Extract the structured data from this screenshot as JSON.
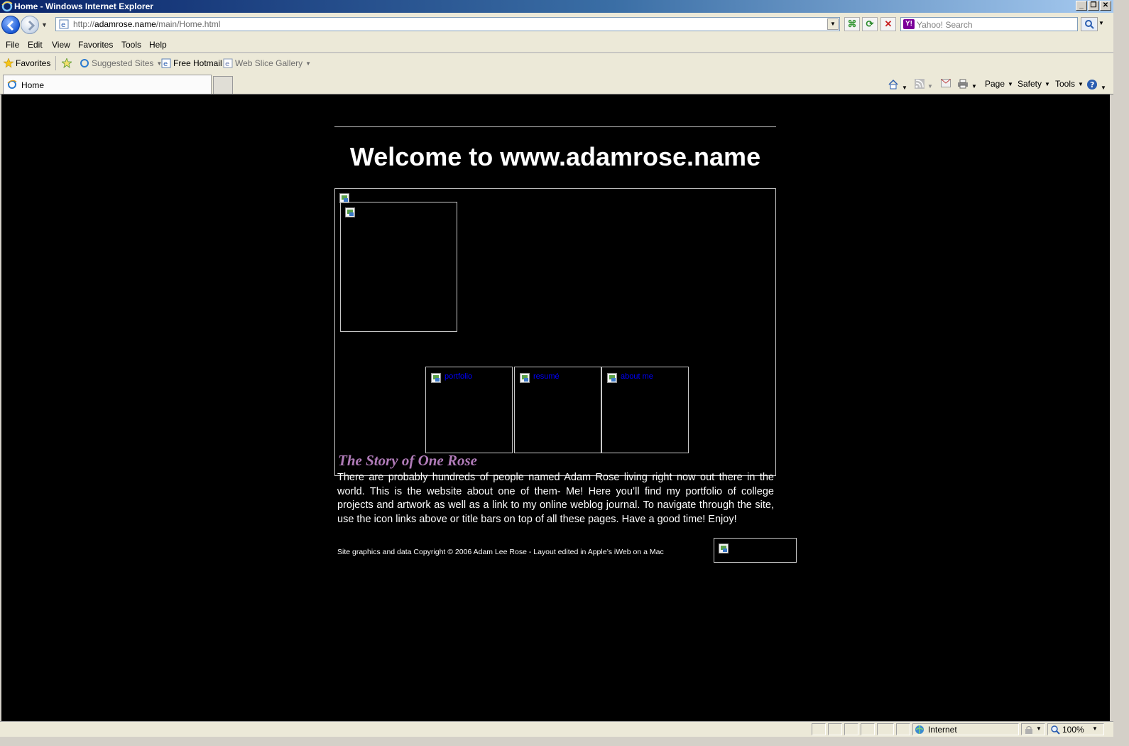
{
  "window": {
    "title": "Home - Windows Internet Explorer"
  },
  "address": {
    "url_prefix": "http://",
    "url_domain": "adamrose.name",
    "url_path": "/main/Home.html"
  },
  "search": {
    "placeholder": "Yahoo! Search",
    "provider_icon": "Y!"
  },
  "menu": [
    "File",
    "Edit",
    "View",
    "Favorites",
    "Tools",
    "Help"
  ],
  "favorites_bar": {
    "favorites_label": "Favorites",
    "suggested_sites": "Suggested Sites",
    "free_hotmail": "Free Hotmail",
    "web_slice_gallery": "Web Slice Gallery"
  },
  "tabs": [
    {
      "label": "Home"
    }
  ],
  "command_bar": {
    "page": "Page",
    "safety": "Safety",
    "tools": "Tools"
  },
  "page": {
    "heading": "Welcome to www.adamrose.name",
    "nav_links": [
      "portfolio",
      "resumé",
      "about me"
    ],
    "story_title": "The Story of One Rose",
    "story_body": "There are probably hundreds of people named Adam Rose living right now out there in the world. This is the website about one of them- Me! Here you’ll find my portfolio of college projects and artwork as well as a link to my online weblog journal. To navigate through the site, use the icon links above or title bars on top of all these pages. Have a good time! Enjoy!",
    "copyright": "Site graphics and data Copyright © 2006 Adam Lee Rose - Layout edited in Apple’s iWeb on a Mac"
  },
  "status_bar": {
    "zone": "Internet",
    "zoom": "100%"
  },
  "colors": {
    "page_background": "#000000",
    "story_title": "#b07bb8",
    "link": "#0000ff"
  }
}
